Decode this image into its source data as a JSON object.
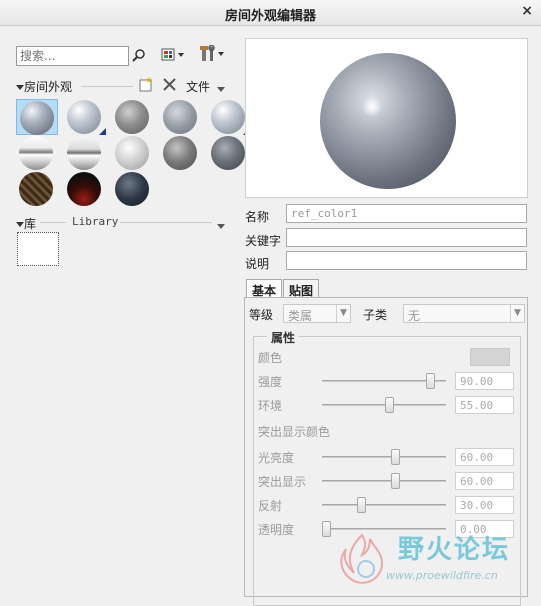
{
  "window": {
    "title": "房间外观编辑器",
    "close_glyph": "×"
  },
  "search": {
    "placeholder": "搜索..."
  },
  "room_section": {
    "label": "房间外观",
    "file_menu": "文件"
  },
  "swatches": [
    {
      "style": "gray-glossy",
      "selected": true,
      "marked": false
    },
    {
      "style": "light-glossy",
      "selected": false,
      "marked": true
    },
    {
      "style": "mid-gray",
      "selected": false,
      "marked": false
    },
    {
      "style": "gray-matte",
      "selected": false,
      "marked": false
    },
    {
      "style": "light-glossy",
      "selected": false,
      "marked": true
    },
    {
      "style": "chrome-band",
      "selected": false,
      "marked": false
    },
    {
      "style": "chrome-band-2",
      "selected": false,
      "marked": false
    },
    {
      "style": "silver",
      "selected": false,
      "marked": false
    },
    {
      "style": "dark-gray",
      "selected": false,
      "marked": false
    },
    {
      "style": "dark-slate",
      "selected": false,
      "marked": false
    },
    {
      "style": "brown-texture",
      "selected": false,
      "marked": false
    },
    {
      "style": "black-red",
      "selected": false,
      "marked": false
    },
    {
      "style": "dark-marble",
      "selected": false,
      "marked": false
    }
  ],
  "library": {
    "label": "库",
    "name": "Library"
  },
  "properties": {
    "name_label": "名称",
    "name_value": "ref_color1",
    "keyword_label": "关键字",
    "keyword_value": "",
    "description_label": "说明",
    "description_value": ""
  },
  "tabs": [
    {
      "label": "基本",
      "active": true
    },
    {
      "label": "贴图",
      "active": false
    }
  ],
  "basic": {
    "level_label": "等级",
    "level_value": "类属",
    "subclass_label": "子类",
    "subclass_value": "无",
    "group_title": "属性",
    "color_label": "颜色",
    "highlight_color_label": "突出显示颜色",
    "sliders": [
      {
        "label": "强度",
        "value": "90.00",
        "fraction": 0.9
      },
      {
        "label": "环境",
        "value": "55.00",
        "fraction": 0.55
      },
      {
        "label": "光亮度",
        "value": "60.00",
        "fraction": 0.6
      },
      {
        "label": "突出显示",
        "value": "60.00",
        "fraction": 0.6
      },
      {
        "label": "反射",
        "value": "30.00",
        "fraction": 0.3
      },
      {
        "label": "透明度",
        "value": "0.00",
        "fraction": 0.0
      }
    ]
  },
  "watermark": {
    "text": "野火论坛",
    "url": "www.proewildfire.cn"
  }
}
